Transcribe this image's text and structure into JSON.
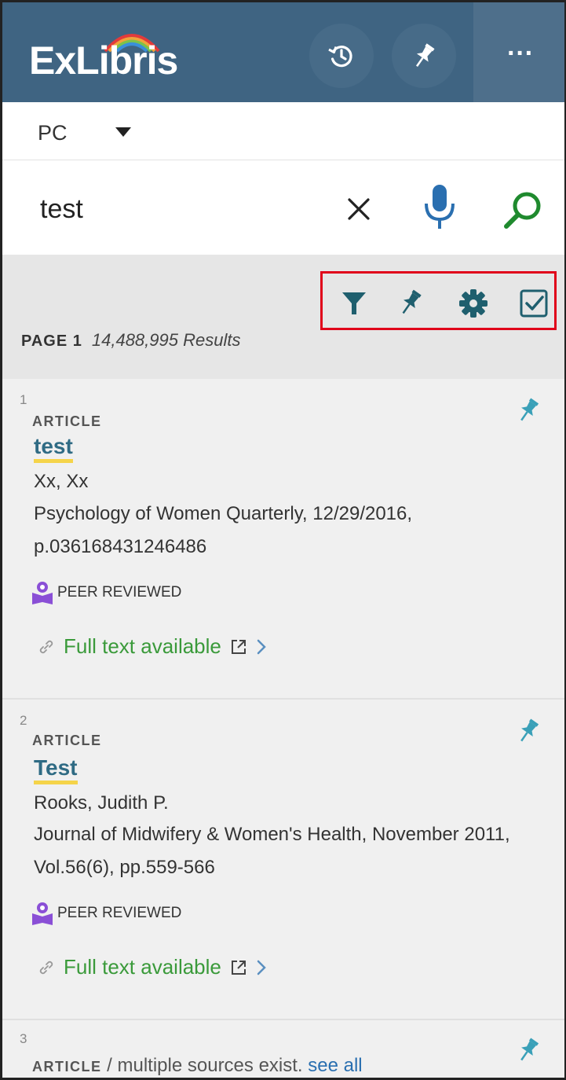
{
  "header": {
    "logo_text": "ExLibris",
    "history_icon": "history-icon",
    "pin_icon": "pushpin-icon",
    "more_label": "···",
    "colors": {
      "bar": "#3f6482",
      "more_zone": "#4e6f8b"
    }
  },
  "scope": {
    "selected": "PC",
    "caret_icon": "caret-down-icon"
  },
  "search": {
    "value": "test",
    "clear_icon": "close-icon",
    "mic_icon": "microphone-icon",
    "search_icon": "search-icon"
  },
  "toolbar": {
    "icons": [
      "filter-icon",
      "pushpin-icon",
      "gear-icon",
      "checkbox-icon"
    ],
    "accent": "#1f5f6e"
  },
  "results_header": {
    "page_label": "PAGE 1",
    "count": "14,488,995 Results"
  },
  "results": [
    {
      "num": "1",
      "type": "ARTICLE",
      "title": "test",
      "author": "Xx, Xx",
      "source": "Psychology of Women Quarterly, 12/29/2016, p.036168431246486",
      "peer": "PEER REVIEWED",
      "fulltext": "Full text available"
    },
    {
      "num": "2",
      "type": "ARTICLE",
      "title": "Test",
      "author": "Rooks, Judith P.",
      "source": "Journal of Midwifery & Women's Health, November 2011, Vol.56(6), pp.559-566",
      "peer": "PEER REVIEWED",
      "fulltext": "Full text available"
    },
    {
      "num": "3",
      "type": "ARTICLE",
      "type_extra": " / multiple sources exist. ",
      "see_all": "see all"
    }
  ]
}
